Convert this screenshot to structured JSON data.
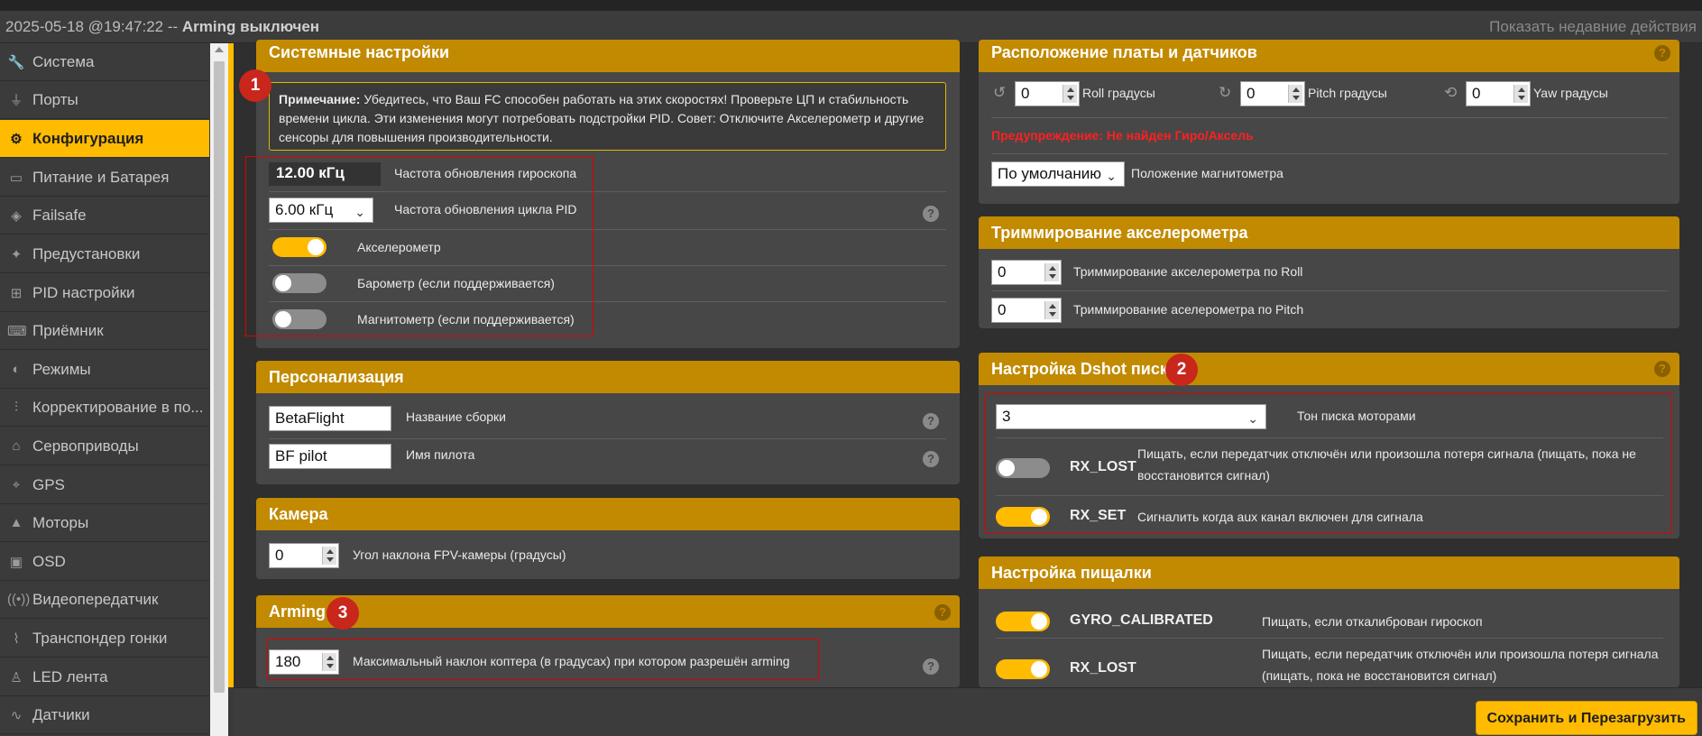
{
  "statusbar": {
    "date": "2025-05-18 @19:47:22 --",
    "arming": "Arming выключен",
    "recent": "Показать недавние действия"
  },
  "sidebar": {
    "items": [
      {
        "label": "Система",
        "icon": "wrench-icon"
      },
      {
        "label": "Порты",
        "icon": "plug-icon"
      },
      {
        "label": "Конфигурация",
        "icon": "gear-icon",
        "active": true
      },
      {
        "label": "Питание и Батарея",
        "icon": "battery-icon"
      },
      {
        "label": "Failsafe",
        "icon": "parachute-icon"
      },
      {
        "label": "Предустановки",
        "icon": "magic-wand-icon"
      },
      {
        "label": "PID настройки",
        "icon": "sitemap-icon"
      },
      {
        "label": "Приёмник",
        "icon": "gamepad-icon"
      },
      {
        "label": "Режимы",
        "icon": "toggle-icon"
      },
      {
        "label": "Корректирование в по...",
        "icon": "sliders-icon"
      },
      {
        "label": "Сервоприводы",
        "icon": "servo-icon"
      },
      {
        "label": "GPS",
        "icon": "satellite-icon"
      },
      {
        "label": "Моторы",
        "icon": "motor-icon"
      },
      {
        "label": "OSD",
        "icon": "osd-icon"
      },
      {
        "label": "Видеопередатчик",
        "icon": "broadcast-icon"
      },
      {
        "label": "Транспондер гонки",
        "icon": "transponder-icon"
      },
      {
        "label": "LED лента",
        "icon": "led-icon"
      },
      {
        "label": "Датчики",
        "icon": "pulse-icon"
      }
    ]
  },
  "system": {
    "title": "Системные настройки",
    "note_bold": "Примечание:",
    "note_text": " Убедитесь, что Ваш FC способен работать на этих скоростях! Проверьте ЦП и стабильность времени цикла. Эти изменения могут потребовать подстройки PID. Совет: Отключите Акселерометр и другие сенсоры для повышения производительности.",
    "gyro_value": "12.00 кГц",
    "gyro_label": "Частота обновления гироскопа",
    "pid_value": "6.00 кГц",
    "pid_label": "Частота обновления цикла PID",
    "accel_label": "Акселерометр",
    "baro_label": "Барометр (если поддерживается)",
    "mag_label": "Магнитометр (если поддерживается)",
    "badge": "1"
  },
  "personal": {
    "title": "Персонализация",
    "craft_value": "BetaFlight",
    "craft_label": "Название сборки",
    "pilot_value": "BF pilot",
    "pilot_label": "Имя пилота"
  },
  "camera": {
    "title": "Камера",
    "angle_value": "0",
    "angle_label": "Угол наклона FPV-камеры (градусы)"
  },
  "arming": {
    "title": "Arming",
    "badge": "3",
    "angle_value": "180",
    "angle_label": "Максимальный наклон коптера (в градусах) при котором разрешён arming"
  },
  "board": {
    "title": "Расположение платы и датчиков",
    "roll_value": "0",
    "roll_label": "Roll градусы",
    "pitch_value": "0",
    "pitch_label": "Pitch градусы",
    "yaw_value": "0",
    "yaw_label": "Yaw градусы",
    "warning": "Предупреждение: Не найден Гиро/Аксель",
    "mag_value": "По умолчанию",
    "mag_label": "Положение магнитометра"
  },
  "accel_trim": {
    "title": "Триммирование акселерометра",
    "roll_value": "0",
    "roll_label": "Триммирование акселерометра по Roll",
    "pitch_value": "0",
    "pitch_label": "Триммирование аселерометра по Pitch"
  },
  "dshot": {
    "title": "Настройка Dshot писка",
    "badge": "2",
    "tone_value": "3",
    "tone_label": "Тон писка моторами",
    "rx_lost_name": "RX_LOST",
    "rx_lost_desc": "Пищать, если передатчик отключён или произошла потеря сигнала (пищать, пока не восстановится сигнал)",
    "rx_set_name": "RX_SET",
    "rx_set_desc": "Сигналить когда aux канал включен для сигнала"
  },
  "beeper": {
    "title": "Настройка пищалки",
    "gyro_name": "GYRO_CALIBRATED",
    "gyro_desc": "Пищать, если откалиброван гироскоп",
    "rx_lost_name": "RX_LOST",
    "rx_lost_desc": "Пищать, если передатчик отключён или произошла потеря сигнала (пищать, пока не восстановится сигнал)"
  },
  "footer": {
    "save_label": "Сохранить и Перезагрузить"
  },
  "colors": {
    "accent": "#ffbb00",
    "panel_header": "#c28a00",
    "warning": "#ff2020",
    "badge": "#c9261c"
  }
}
